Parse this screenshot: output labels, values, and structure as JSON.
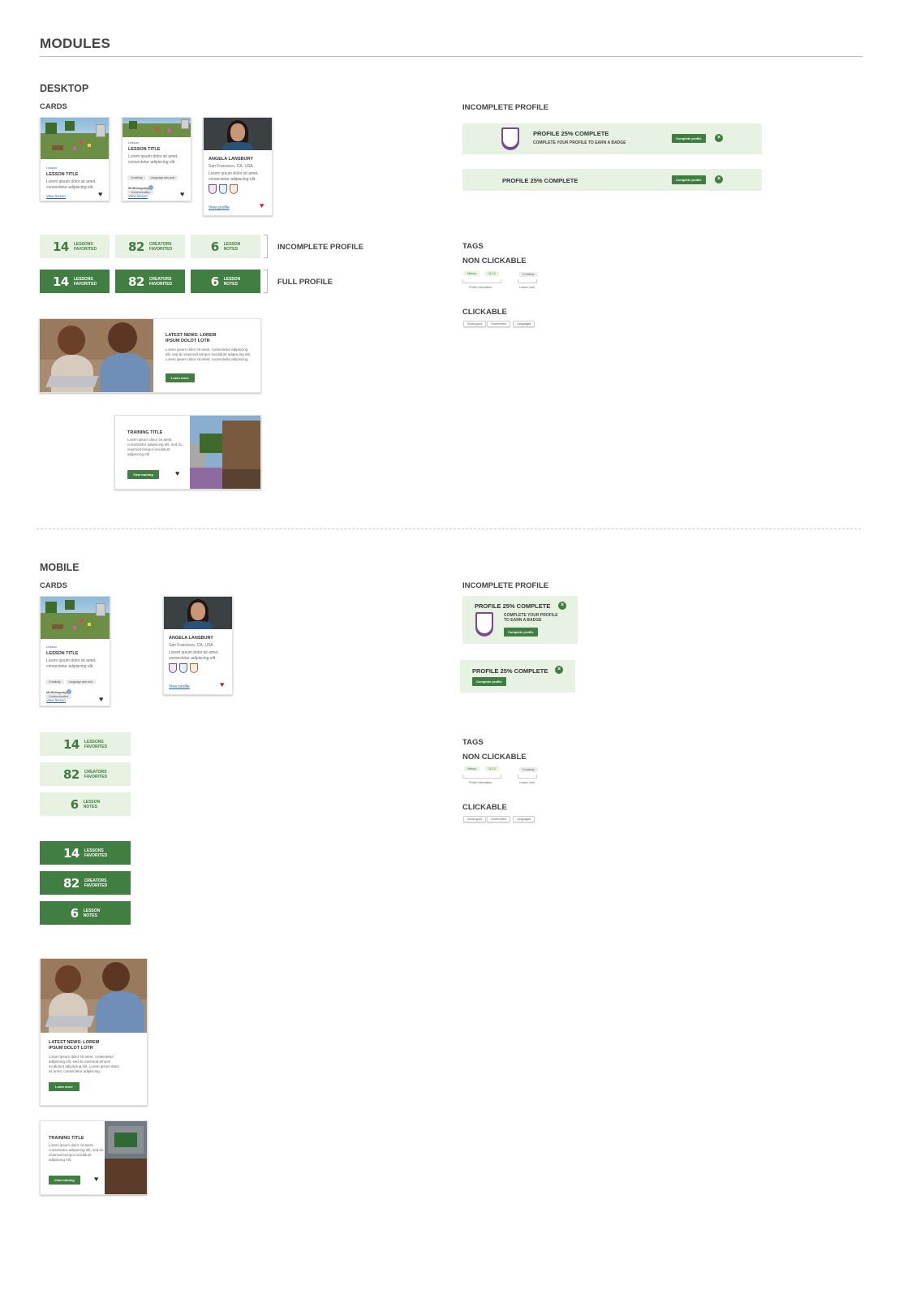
{
  "page": {
    "title": "MODULES"
  },
  "desktop": {
    "heading": "DESKTOP",
    "cards_label": "CARDS",
    "lesson_card_1": {
      "eyebrow": "Lesson",
      "title": "LESSON TITLE",
      "body": "Lorem ipsum dolor sit amet, consectetur adipiscing elit.",
      "link": "View lesson"
    },
    "lesson_card_2": {
      "eyebrow": "Lesson",
      "title": "LESSON TITLE",
      "body": "Lorem ipsum dolor sit amet, consectetur adipiscing elit.",
      "tags": [
        "Creativity",
        "Language arts and",
        "Communication"
      ],
      "meta": "Multilanguage",
      "link": "View lesson"
    },
    "creator_card": {
      "name": "ANGELA LANSBURY",
      "location": "San Francisco, CA, USA",
      "body": "Lorem ipsum dolor sit amet, consectetur adipiscing elit.",
      "link": "View profile"
    },
    "stats_incomplete": [
      {
        "num": "14",
        "l1": "LESSONS",
        "l2": "FAVORITED"
      },
      {
        "num": "82",
        "l1": "CREATORS",
        "l2": "FAVORITED"
      },
      {
        "num": "6",
        "l1": "LESSON",
        "l2": "NOTES"
      }
    ],
    "stats_full": [
      {
        "num": "14",
        "l1": "LESSONS",
        "l2": "FAVORITED"
      },
      {
        "num": "82",
        "l1": "CREATORS",
        "l2": "FAVORITED"
      },
      {
        "num": "6",
        "l1": "LESSON",
        "l2": "NOTES"
      }
    ],
    "incomplete_profile_label": "INCOMPLETE PROFILE",
    "full_profile_label": "FULL PROFILE",
    "news": {
      "title1": "LATEST NEWS: LOREM",
      "title2": "IPSUM DOLOT LOTR",
      "body": "Lorem ipsum dolor sit amet, consectetur adipiscing elit, sed do eiusmod tempor incididunt adipiscing elit. Lorem ipsum dolor sit amet, consectetur adipiscing.",
      "button": "Learn more"
    },
    "training": {
      "title": "TRAINING TITLE",
      "body": "Lorem ipsum dolor sit amet, consectetur adipiscing elit, sed do eiusmod tempor incididunt adipiscing elit.",
      "button": "View training"
    },
    "profile_heading": "INCOMPLETE PROFILE",
    "banner1": {
      "title": "PROFILE 25% COMPLETE",
      "sub": "COMPLETE YOUR PROFILE TO EARN A BADGE",
      "button": "Complete profile"
    },
    "banner2": {
      "title": "PROFILE 25% COMPLETE",
      "button": "Complete profile"
    },
    "tags_heading": "TAGS",
    "non_clickable": "NON CLICKABLE",
    "nc_tags": [
      "History",
      "11-13",
      "Creativity"
    ],
    "nc_captions": [
      "Profile information",
      "Lesson card"
    ],
    "clickable": "CLICKABLE",
    "clk_tags": [
      "Social good",
      "Government",
      "Languages"
    ]
  },
  "mobile": {
    "heading": "MOBILE",
    "cards_label": "CARDS",
    "lesson_card": {
      "eyebrow": "Lesson",
      "title": "LESSON TITLE",
      "body": "Lorem ipsum dolor sit amet, consectetur adipiscing elit.",
      "tags": [
        "Creativity",
        "Language arts and",
        "Communication"
      ],
      "meta": "Multilanguage",
      "link": "View lesson"
    },
    "creator_card": {
      "name": "ANGELA LANSBURY",
      "location": "San Francisco, CA, USA",
      "body": "Lorem ipsum dolor sit amet, consectetur adipiscing elit.",
      "link": "View profile"
    },
    "stats_light": [
      {
        "num": "14",
        "l1": "LESSONS",
        "l2": "FAVORITED"
      },
      {
        "num": "82",
        "l1": "CREATORS",
        "l2": "FAVORITED"
      },
      {
        "num": "6",
        "l1": "LESSON",
        "l2": "NOTES"
      }
    ],
    "stats_dark": [
      {
        "num": "14",
        "l1": "LESSONS",
        "l2": "FAVORITED"
      },
      {
        "num": "82",
        "l1": "CREATORS",
        "l2": "FAVORITED"
      },
      {
        "num": "6",
        "l1": "LESSON",
        "l2": "NOTES"
      }
    ],
    "news": {
      "title1": "LATEST NEWS: LOREM",
      "title2": "IPSUM DOLOT LOTR",
      "body": "Lorem ipsum dolor sit amet, consectetur adipiscing elit, sed do eiusmod tempor incididunt adipiscing elit. Lorem ipsum dolor sit amet, consectetur adipiscing.",
      "button": "Learn more"
    },
    "training": {
      "title": "TRAINING TITLE",
      "body": "Lorem ipsum dolor sit amet, consectetur adipiscing elit, sed do eiusmod tempor incididunt adipiscing elit.",
      "button": "View training"
    },
    "profile_heading": "INCOMPLETE PROFILE",
    "banner1": {
      "title": "PROFILE 25% COMPLETE",
      "sub1": "COMPLETE YOUR PROFILE",
      "sub2": "TO EARN A BADGE",
      "button": "Complete profile"
    },
    "banner2": {
      "title": "PROFILE 25% COMPLETE",
      "button": "Complete profile"
    },
    "tags_heading": "TAGS",
    "non_clickable": "NON CLICKABLE",
    "nc_tags": [
      "History",
      "11-13",
      "Creativity"
    ],
    "nc_captions": [
      "Profile information",
      "Lesson card"
    ],
    "clickable": "CLICKABLE",
    "clk_tags": [
      "Social good",
      "Government",
      "Languages"
    ]
  },
  "colors": {
    "accent_green": "#407e41",
    "light_green": "#e7f2e3",
    "link_blue": "#2a64a8",
    "heart_red": "#c81e1e",
    "badge_purple": "#7a4a91"
  },
  "icons": [
    "heart-icon",
    "close-icon",
    "badge-icon",
    "shield-icon"
  ]
}
